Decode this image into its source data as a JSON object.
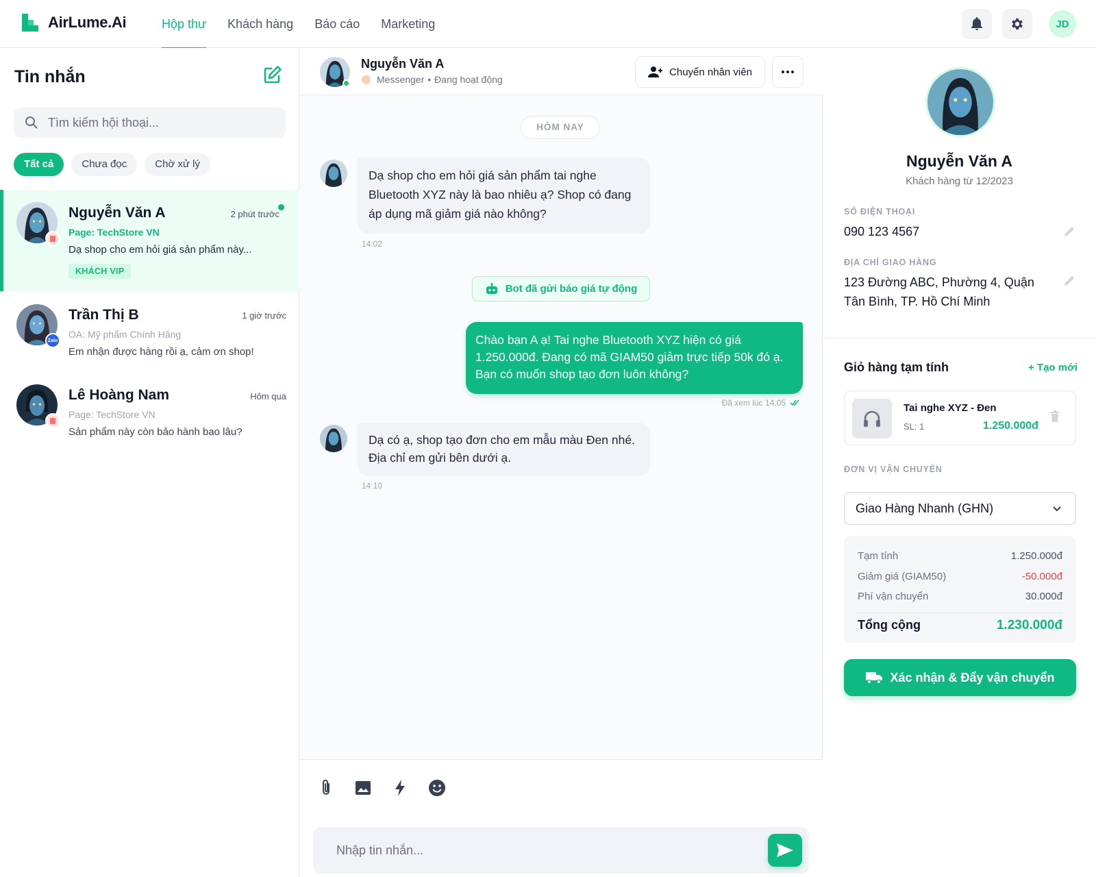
{
  "app": {
    "name": "AirLume.Ai",
    "user_initials": "JD",
    "accent": "#10b981"
  },
  "nav": {
    "items": [
      "Hộp thư",
      "Khách hàng",
      "Báo cáo",
      "Marketing"
    ],
    "active": "Hộp thư"
  },
  "inbox": {
    "title": "Tin nhắn",
    "search_placeholder": "Tìm kiếm hội thoại...",
    "filters": [
      "Tất cả",
      "Chưa đọc",
      "Chờ xử lý"
    ],
    "conversations": [
      {
        "name": "Nguyễn Văn A",
        "time": "2 phút trước",
        "page": "Page: TechStore VN",
        "preview": "Dạ shop cho em hỏi giá sản phẩm này...",
        "tag": "KHÁCH VIP",
        "channel": "messenger",
        "unread": true,
        "active": true
      },
      {
        "name": "Trần Thị B",
        "time": "1 giờ trước",
        "page": "OA: Mỹ phẩm Chính Hãng",
        "preview": "Em nhận được hàng rồi ạ, cảm ơn shop!",
        "channel": "zalo",
        "channel_label": "Zalo"
      },
      {
        "name": "Lê Hoàng Nam",
        "time": "Hôm qua",
        "page": "Page: TechStore VN",
        "preview": "Sản phẩm này còn bảo hành bao lâu?",
        "channel": "messenger"
      }
    ]
  },
  "chat": {
    "contact_name": "Nguyễn Văn A",
    "channel": "Messenger",
    "status": "Đang hoạt động",
    "transfer_label": "Chuyển nhân viên",
    "day_label": "HÔM NAY",
    "messages": [
      {
        "from": "customer",
        "text_lines": [
          "Dạ shop cho em hỏi giá sản phẩm tai nghe",
          "Bluetooth XYZ này là bao nhiêu ạ? Shop có đang",
          "áp dụng mã giảm giá nào không?"
        ],
        "time": "14:02"
      },
      {
        "from": "system",
        "text": "Bot đã gửi báo giá tự động"
      },
      {
        "from": "agent",
        "text": "Chào bạn A ạ! Tai nghe Bluetooth XYZ hiện có giá 1.250.000đ. Đang có mã GIAM50 giảm trực tiếp 50k đó ạ. Bạn có muốn shop tạo đơn luôn không?",
        "seen": "Đã xem lúc 14:05"
      },
      {
        "from": "customer",
        "text_lines": [
          "Dạ có ạ, shop tạo đơn cho em mẫu màu Đen nhé.",
          "Địa chỉ em gửi bên dưới ạ."
        ],
        "time": "14:10"
      }
    ],
    "input_placeholder": "Nhập tin nhắn..."
  },
  "customer": {
    "name": "Nguyễn Văn A",
    "since": "Khách hàng từ 12/2023",
    "phone_label": "SỐ ĐIỆN THOẠI",
    "phone": "090 123 4567",
    "address_label": "ĐỊA CHỈ GIAO HÀNG",
    "address_lines": [
      "123 Đường ABC, Phường 4, Quận",
      "Tân Bình, TP. Hồ Chí Minh"
    ]
  },
  "cart": {
    "title": "Giỏ hàng tạm tính",
    "new_label": "+ Tạo mới",
    "item": {
      "name": "Tai nghe XYZ - Đen",
      "qty": "SL: 1",
      "price": "1.250.000đ"
    },
    "shipping_label": "ĐƠN VỊ VẬN CHUYỂN",
    "shipping_value": "Giao Hàng Nhanh (GHN)",
    "summary": {
      "subtotal_label": "Tạm tính",
      "subtotal": "1.250.000đ",
      "discount_label": "Giảm giá (GIAM50)",
      "discount": "-50.000đ",
      "shipping_fee_label": "Phí vận chuyển",
      "shipping_fee": "30.000đ",
      "total_label": "Tổng cộng",
      "total": "1.230.000đ"
    },
    "confirm_label": "Xác nhận & Đẩy vận chuyển"
  }
}
